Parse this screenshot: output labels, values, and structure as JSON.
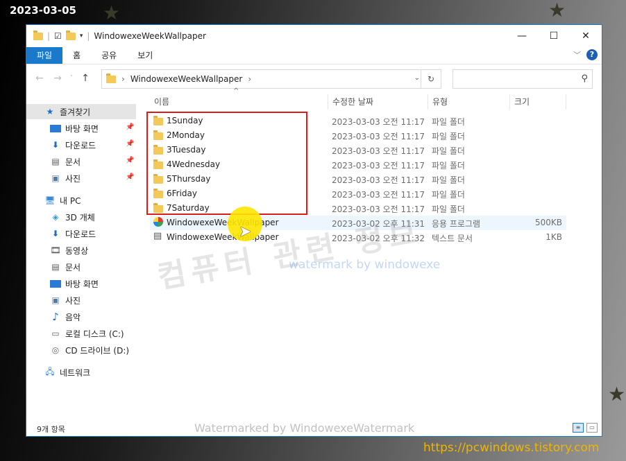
{
  "overlay": {
    "date": "2023-03-05",
    "url": "https://pcwindows.tistory.com",
    "watermark_kr": "컴퓨터 관련 정보",
    "watermark_en": "watermark by windowexe",
    "watermark_status": "Watermarked by WindowexeWatermark"
  },
  "window": {
    "title": "WindowexeWeekWallpaper",
    "controls": [
      "—",
      "☐",
      "✕"
    ]
  },
  "ribbon": {
    "tabs": [
      "파일",
      "홈",
      "공유",
      "보기"
    ],
    "help": "?"
  },
  "address": {
    "path": "WindowexeWeekWallpaper",
    "refresh_icon": "refresh-icon",
    "search_icon": "search-icon"
  },
  "sidebar": {
    "items": [
      {
        "label": "즐겨찾기",
        "icon": "star-icon"
      },
      {
        "label": "바탕 화면",
        "icon": "desktop-icon",
        "pinned": true
      },
      {
        "label": "다운로드",
        "icon": "download-icon",
        "pinned": true
      },
      {
        "label": "문서",
        "icon": "document-icon",
        "pinned": true
      },
      {
        "label": "사진",
        "icon": "picture-icon",
        "pinned": true
      },
      {
        "label": "내 PC",
        "icon": "pc-icon"
      },
      {
        "label": "3D 개체",
        "icon": "cube-icon"
      },
      {
        "label": "다운로드",
        "icon": "download-icon"
      },
      {
        "label": "동영상",
        "icon": "video-icon"
      },
      {
        "label": "문서",
        "icon": "document-icon"
      },
      {
        "label": "바탕 화면",
        "icon": "desktop-icon"
      },
      {
        "label": "사진",
        "icon": "picture-icon"
      },
      {
        "label": "음악",
        "icon": "music-icon"
      },
      {
        "label": "로컬 디스크 (C:)",
        "icon": "drive-icon"
      },
      {
        "label": "CD 드라이브 (D:)",
        "icon": "cd-icon"
      },
      {
        "label": "네트워크",
        "icon": "network-icon"
      }
    ]
  },
  "columns": {
    "name": "이름",
    "date": "수정한 날짜",
    "type": "유형",
    "size": "크기"
  },
  "files": [
    {
      "name": "1Sunday",
      "date": "2023-03-03 오전 11:17",
      "type": "파일 폴더",
      "size": "",
      "icon": "folder-icon"
    },
    {
      "name": "2Monday",
      "date": "2023-03-03 오전 11:17",
      "type": "파일 폴더",
      "size": "",
      "icon": "folder-icon"
    },
    {
      "name": "3Tuesday",
      "date": "2023-03-03 오전 11:17",
      "type": "파일 폴더",
      "size": "",
      "icon": "folder-icon"
    },
    {
      "name": "4Wednesday",
      "date": "2023-03-03 오전 11:17",
      "type": "파일 폴더",
      "size": "",
      "icon": "folder-icon"
    },
    {
      "name": "5Thursday",
      "date": "2023-03-03 오전 11:17",
      "type": "파일 폴더",
      "size": "",
      "icon": "folder-icon"
    },
    {
      "name": "6Friday",
      "date": "2023-03-03 오전 11:17",
      "type": "파일 폴더",
      "size": "",
      "icon": "folder-icon"
    },
    {
      "name": "7Saturday",
      "date": "2023-03-03 오전 11:17",
      "type": "파일 폴더",
      "size": "",
      "icon": "folder-icon"
    },
    {
      "name": "WindowexeWeekWallpaper",
      "date": "2023-03-02 오후 11:31",
      "type": "응용 프로그램",
      "size": "500KB",
      "icon": "app-icon"
    },
    {
      "name": "WindowexeWeekWallpaper",
      "date": "2023-03-02 오후 11:32",
      "type": "텍스트 문서",
      "size": "1KB",
      "icon": "text-file-icon"
    }
  ],
  "status": {
    "count": "9개 항목"
  },
  "colors": {
    "accent": "#1979ca",
    "highlight_box": "#d91e18",
    "url": "#f0b400"
  }
}
